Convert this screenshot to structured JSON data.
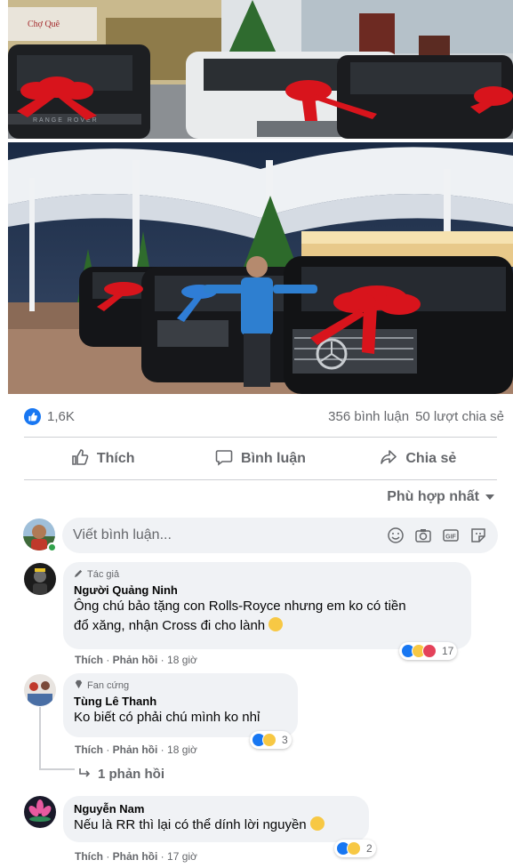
{
  "post": {
    "reactions_count": "1,6K",
    "comments_count": "356 bình luận",
    "shares_count": "50 lượt chia sẻ"
  },
  "actions": {
    "like": "Thích",
    "comment": "Bình luận",
    "share": "Chia sẻ"
  },
  "sort_label": "Phù hợp nhất",
  "composer": {
    "placeholder": "Viết bình luận..."
  },
  "photo_top": {
    "shop_sign": "Chợ Quê",
    "car_plate_text": "RANGE ROVER"
  },
  "comments": [
    {
      "badge": "Tác giả",
      "author": "Người Quảng Ninh",
      "text_line1": "Ông chú bảo tặng con Rolls-Royce nhưng em ko có tiền",
      "text_line2": "đổ xăng, nhận Cross đi cho lành",
      "like_label": "Thích",
      "reply_label": "Phản hồi",
      "time": "18 giờ",
      "reactions": "17"
    },
    {
      "badge": "Fan cứng",
      "author": "Tùng Lê Thanh",
      "text_line1": "Ko biết có phải chú mình ko nhỉ",
      "like_label": "Thích",
      "reply_label": "Phản hồi",
      "time": "18 giờ",
      "reactions": "3",
      "replies_label": "1 phản hồi"
    },
    {
      "author": "Nguyễn Nam",
      "text_line1": "Nếu là RR thì lại có thể dính lời nguyền",
      "like_label": "Thích",
      "reply_label": "Phản hồi",
      "time": "17 giờ",
      "reactions": "2"
    }
  ],
  "colors": {
    "facebook_blue": "#1877f2",
    "bubble_bg": "#f0f2f5",
    "secondary_text": "#65676b",
    "ribbon_red": "#d8141c"
  }
}
